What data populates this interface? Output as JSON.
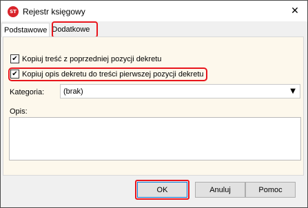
{
  "window": {
    "title": "Rejestr księgowy",
    "icon_text": "ST",
    "close_glyph": "✕"
  },
  "tabs": [
    {
      "label": "Podstawowe",
      "active": true
    },
    {
      "label": "Dodatkowe",
      "active": false
    }
  ],
  "options": {
    "copy_content": {
      "label": "Kopiuj treść z poprzedniej pozycji dekretu",
      "checked": true
    },
    "copy_description": {
      "label": "Kopiuj opis dekretu do treści pierwszej pozycji dekretu",
      "checked": true
    }
  },
  "category": {
    "label": "Kategoria:",
    "value": "(brak)"
  },
  "description": {
    "label": "Opis:",
    "value": ""
  },
  "buttons": {
    "ok": "OK",
    "cancel": "Anuluj",
    "help": "Pomoc"
  },
  "check_glyph": "✔",
  "colors": {
    "highlight": "#e8141b",
    "panel_bg": "#fdf8ec",
    "icon_red": "#d9242b"
  }
}
